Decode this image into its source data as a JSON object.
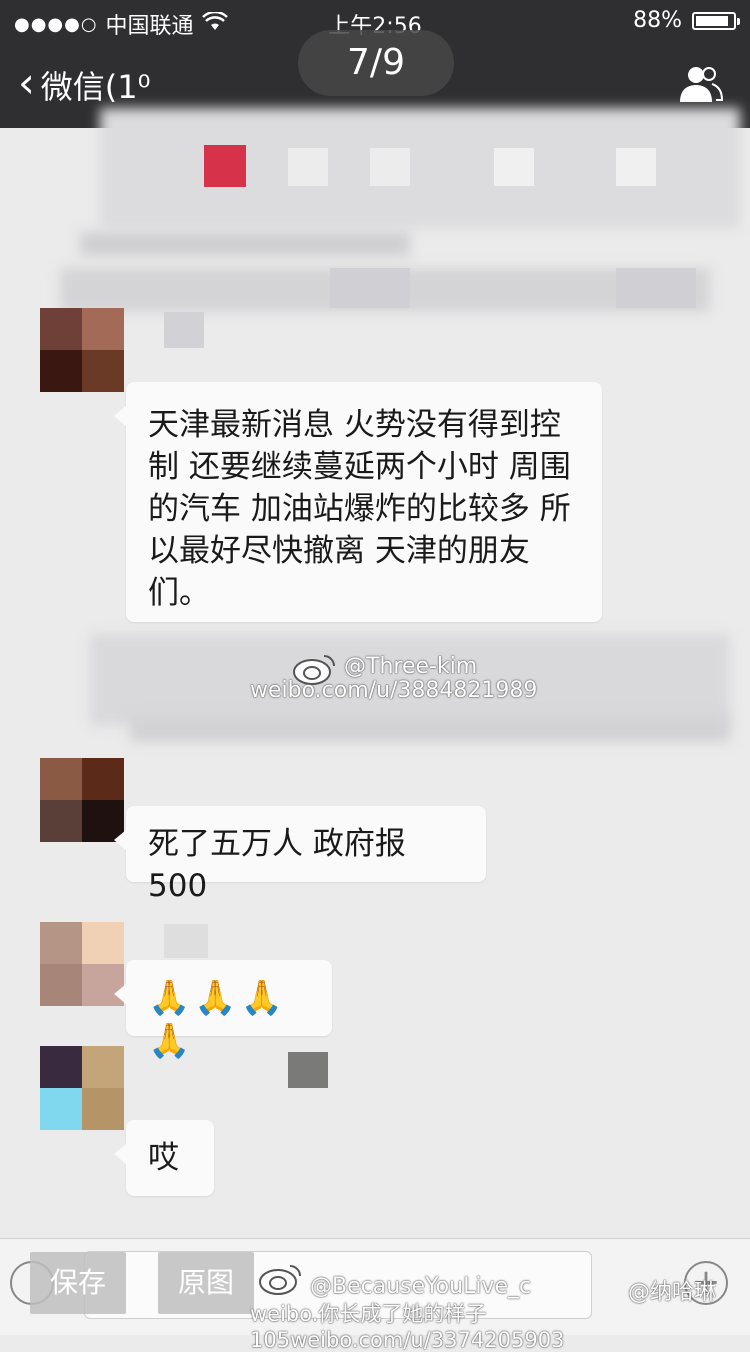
{
  "status_bar": {
    "carrier": "中国联通",
    "time": "上午2:56",
    "battery_label": "88%",
    "battery_level": 0.88
  },
  "nav": {
    "back_label": "微信(1⁰",
    "contacts_icon": "group-contacts-icon"
  },
  "viewer": {
    "page_counter": "7/9",
    "save_label": "保存",
    "original_label": "原图"
  },
  "messages": [
    {
      "text": "天津最新消息 火势没有得到控制 还要继续蔓延两个小时 周围的汽车 加油站爆炸的比较多 所以最好尽快撤离 天津的朋友们。"
    },
    {
      "text": "死了五万人 政府报500"
    },
    {
      "text": "🙏🙏🙏🙏"
    },
    {
      "text": "哎"
    }
  ],
  "watermarks": {
    "middle_handle": "@Three-kim",
    "middle_url": "weibo.com/u/3884821989",
    "bottom_handle": "@BecauseYouLive_c",
    "bottom_line": "weibo.你长成了她的样子105weibo.com/u/3374205903",
    "bottom_right_handle": "@纳哈琳"
  },
  "colors": {
    "topbar": "#2f2f31",
    "background": "#ebebeb",
    "bubble": "#fafafa"
  }
}
